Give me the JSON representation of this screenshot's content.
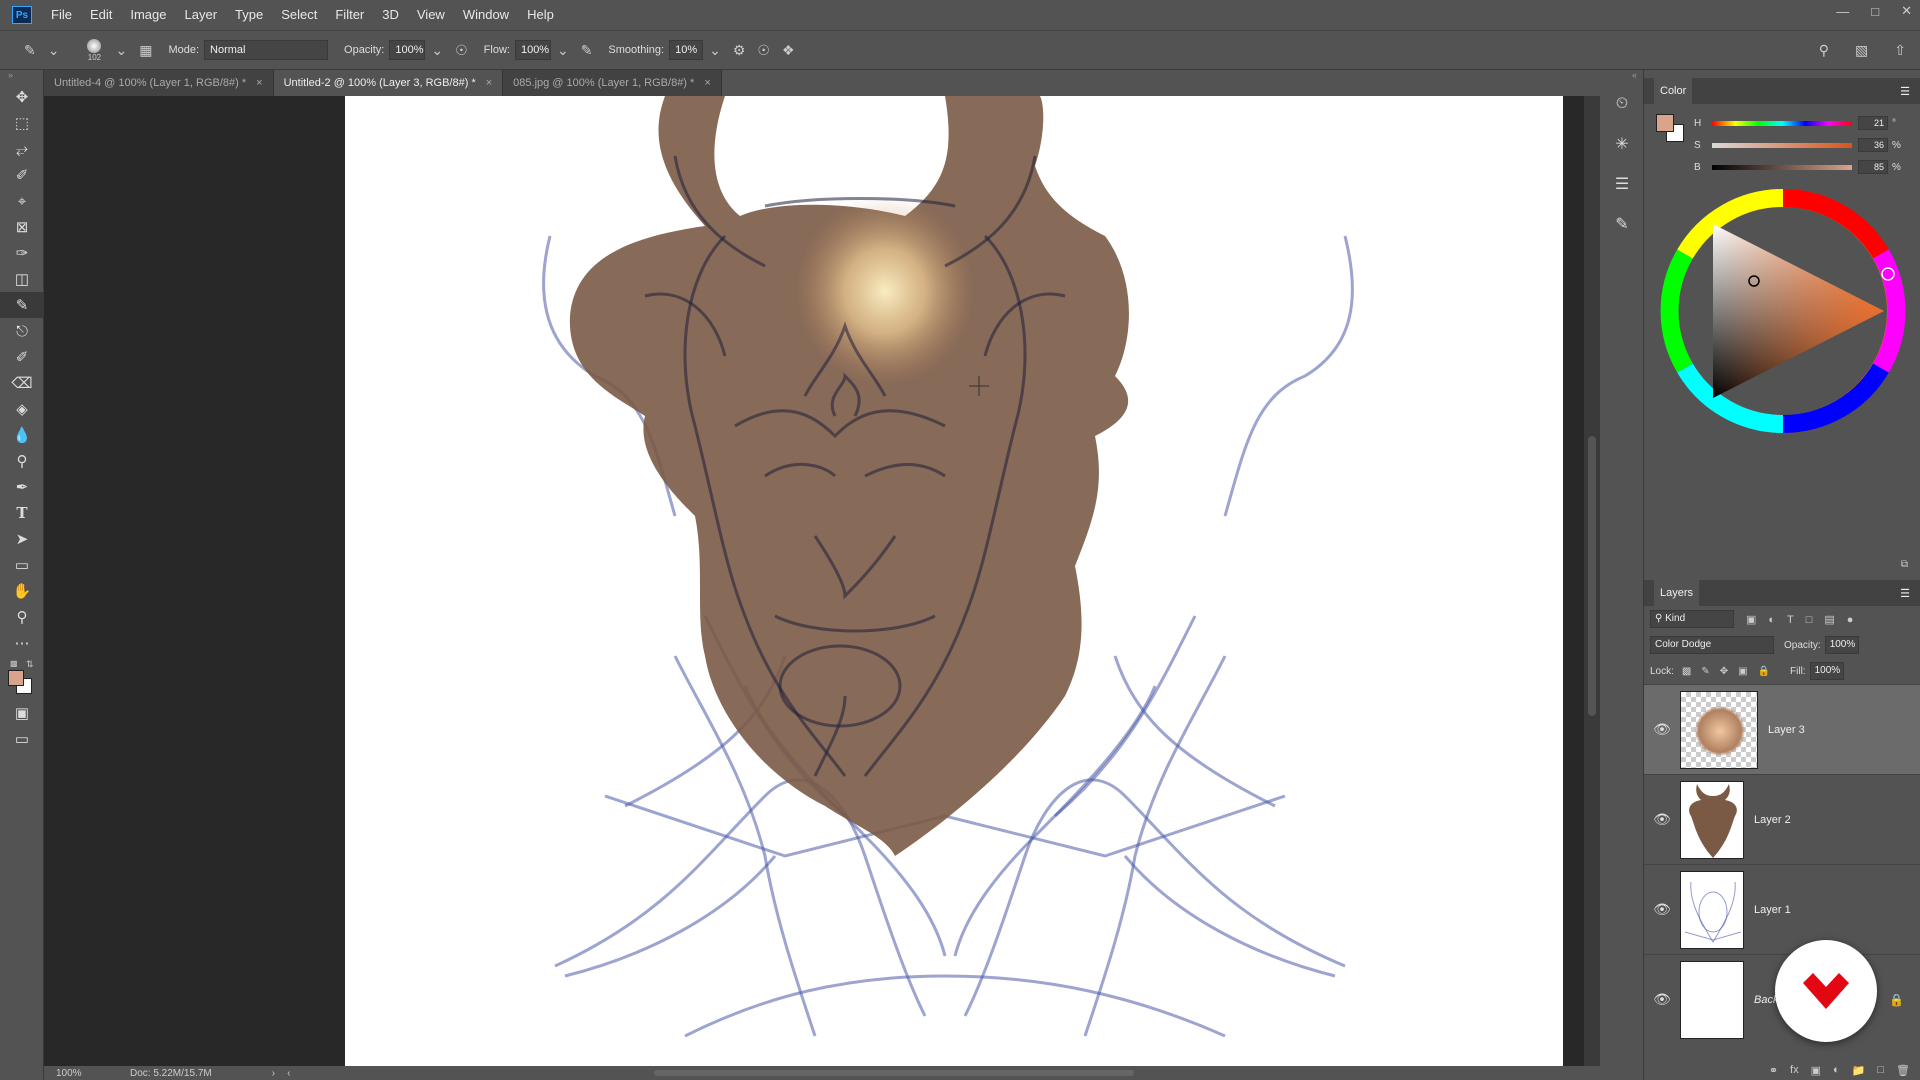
{
  "app": {
    "logo": "Ps",
    "menu": [
      "File",
      "Edit",
      "Image",
      "Layer",
      "Type",
      "Select",
      "Filter",
      "3D",
      "View",
      "Window",
      "Help"
    ]
  },
  "options": {
    "brush_size": "102",
    "mode_label": "Mode:",
    "mode_value": "Normal",
    "opacity_label": "Opacity:",
    "opacity_value": "100%",
    "flow_label": "Flow:",
    "flow_value": "100%",
    "smoothing_label": "Smoothing:",
    "smoothing_value": "10%"
  },
  "tabs": [
    {
      "label": "Untitled-4 @ 100% (Layer 1, RGB/8#) *"
    },
    {
      "label": "Untitled-2 @ 100% (Layer 3, RGB/8#) *"
    },
    {
      "label": "085.jpg @ 100% (Layer 1, RGB/8#) *"
    }
  ],
  "status": {
    "zoom": "100%",
    "doc": "Doc: 5.22M/15.7M"
  },
  "color_panel": {
    "title": "Color",
    "h_label": "H",
    "h_value": "21",
    "h_unit": "°",
    "s_label": "S",
    "s_value": "36",
    "s_unit": "%",
    "b_label": "B",
    "b_value": "85",
    "b_unit": "%",
    "foreground": "#d9a48b",
    "background": "#ffffff"
  },
  "layers_panel": {
    "title": "Layers",
    "filter_kind": "Kind",
    "blend_mode": "Color Dodge",
    "opacity_label": "Opacity:",
    "opacity_value": "100%",
    "lock_label": "Lock:",
    "fill_label": "Fill:",
    "fill_value": "100%",
    "layers": [
      {
        "name": "Layer 3",
        "visible": true,
        "selected": true
      },
      {
        "name": "Layer 2",
        "visible": true
      },
      {
        "name": "Layer 1",
        "visible": true
      },
      {
        "name": "Background",
        "visible": true
      }
    ]
  },
  "colors": {
    "ui_bg": "#535353",
    "canvas_bg": "#282828",
    "sketch_blue": "#4a5aa8",
    "fill_brown": "#7a5a45",
    "badge_red": "#e30613"
  }
}
